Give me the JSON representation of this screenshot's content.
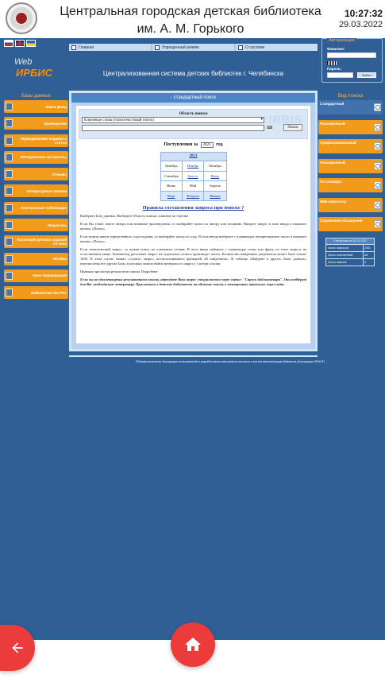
{
  "header": {
    "library_name_line1": "Центральная городская детская библиотека",
    "library_name_line2": "им. А. М. Горького",
    "time": "10:27:32",
    "date": "29.03.2022"
  },
  "brand": {
    "web": "Web",
    "irbis": "ИРБИС"
  },
  "flags": [
    "ru-flag-icon",
    "en-flag-icon",
    "ua-flag-icon"
  ],
  "topnav": [
    {
      "label": "Главная",
      "icon": "home-icon"
    },
    {
      "label": "Упрощенный режим",
      "icon": "mode-icon"
    },
    {
      "label": "О системе",
      "icon": "info-icon"
    }
  ],
  "banner_title": "Централизованная система детских библиотек г. Челябинска",
  "auth": {
    "title": "Авторизация",
    "login_label": "Фамилия:",
    "password_label": "Пароль:",
    "submit_label": "Войти"
  },
  "left_sidebar": {
    "title": "Базы данных",
    "items": [
      "Книги фонд",
      "Краеведение",
      "Периодические издания и статьи",
      "Методические материалы",
      "Отзывы",
      "Литературные премии",
      "Электронные публикации",
      "Медиатека",
      "Коллекция детских изданий XX века",
      "Читайка",
      "Нине Пивоваровой",
      "Библиотеки без Рос"
    ]
  },
  "right_sidebar": {
    "title": "Вид поиска",
    "items": [
      "Стандартный",
      "Расширенный",
      "Профессиональный",
      "Расширенный",
      "По словарю",
      "ББК-навигатор",
      "Справочник обращений"
    ],
    "active_index": 0
  },
  "stats": {
    "title": "Статистика на 29.03.2022",
    "rows": [
      {
        "label": "Число запросов",
        "value": "2301"
      },
      {
        "label": "Число посетителей",
        "value": "48"
      },
      {
        "label": "Число заказов",
        "value": "0"
      }
    ]
  },
  "main": {
    "header": "- стандартный поиск",
    "search_area_label": "Область поиска",
    "search_select_value": "Ключевые слова (полнотекстовый поиск)",
    "keyboard_label": "⌨",
    "search_button": "Поиск",
    "watermark": "IRBIS",
    "arrivals_prefix": "Поступления за",
    "arrivals_year": "2021",
    "arrivals_suffix": "год",
    "calendar": {
      "year": "2021",
      "months": [
        {
          "name": "Декабрь",
          "link": false
        },
        {
          "name": "Ноябрь",
          "link": true
        },
        {
          "name": "Октябрь",
          "link": false
        },
        {
          "name": "Сентябрь",
          "link": false
        },
        {
          "name": "Август",
          "link": true
        },
        {
          "name": "Июль",
          "link": true
        },
        {
          "name": "Июнь",
          "link": false
        },
        {
          "name": "Май",
          "link": false
        },
        {
          "name": "Апрель",
          "link": false
        },
        {
          "name": "Март",
          "link": true
        },
        {
          "name": "Февраль",
          "link": true
        },
        {
          "name": "Январь",
          "link": true
        }
      ]
    },
    "rules_link": "Правила составления запроса при поиске ?",
    "p1": "Выберите Базу данных. Выберите Область поиска, кликнув по стрелке.",
    "p2": "Если Вы точно знаете автора или название произведения, то выбирайте поиск по автору или заглавию. Введите запрос в поле ввода и нажмите кнопку «Поиск».",
    "p3": "Если нужны книги определенного года издания, то выбирайте поиск по году. В поле ввода выберите с клавиатуры четырехзначное число и нажмите кнопку «Поиск».",
    "p4": "Если тематический запрос, то нужен поиск по ключевым словам. В поле ввода наберите с клавиатуры слово или фразу по теме запроса на естественном языке. Компьютер расчленит запрос на отдельные слова и произведет поиск. Количество найденных документов может быть свыше 1000. В этом случае можно «сузить» запрос, воспользовавшись функцией «В найденном». В таблице «Найдено в других базах данных» перечислены все другие Базы, в которых можно найти материал по запросу. Смотри ссылки.",
    "p5": "Правила просмотра результатов поиска Подробнее",
    "p6": "Если вы не удовлетворены результатами поиска, адресуйте Ваш запрос специалистам через сервис: \"Спроси библиотекаря\". Они подберут для Вас необходимую литературу. Приглашаем в детские библиотеки на обучение поиску в электронных каталогах через сайт."
  },
  "footer_note": "©Межрегиональная Ассоциация пользователей и разработчиков электронного каталога и систем автоматизации библиотек (Ассоциация ЭБНИТ)",
  "fabs": {
    "back": "arrow-left-icon",
    "home": "home-icon"
  }
}
